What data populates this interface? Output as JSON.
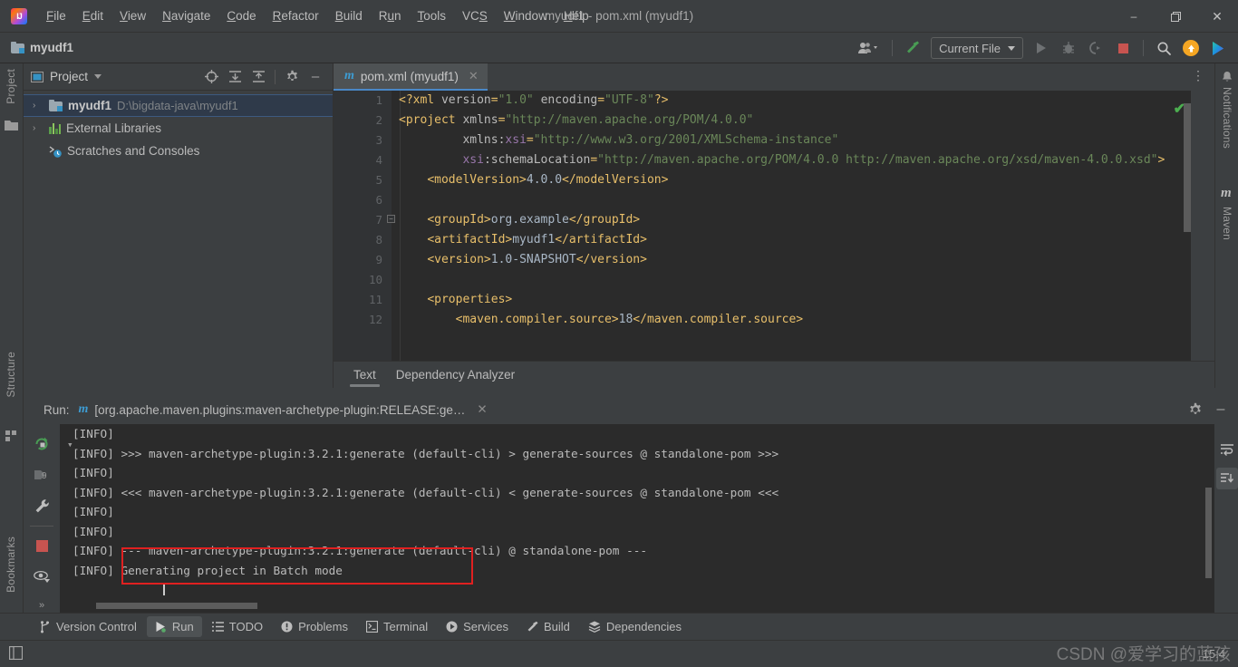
{
  "window": {
    "title": "myudf1 - pom.xml (myudf1)",
    "minimize": "─",
    "maximize": "❐",
    "close": "✕",
    "logo_text": "IJ"
  },
  "menu": {
    "items": [
      "File",
      "Edit",
      "View",
      "Navigate",
      "Code",
      "Refactor",
      "Build",
      "Run",
      "Tools",
      "VCS",
      "Window",
      "Help"
    ]
  },
  "navbar": {
    "project_name": "myudf1",
    "run_config": "Current File",
    "icons": {
      "account": "account-icon",
      "build": "hammer-icon",
      "run": "run-icon",
      "debug": "debug-icon",
      "coverage": "run-coverage-icon",
      "stop": "stop-icon",
      "search": "search-icon",
      "update": "update-icon",
      "ide_feature": "ide-feature-icon"
    }
  },
  "left_strip": {
    "project_label": "Project",
    "structure_label": "Structure",
    "bookmarks_label": "Bookmarks"
  },
  "right_strip": {
    "notifications_label": "Notifications",
    "maven_label": "Maven",
    "maven_glyph": "m"
  },
  "project_panel": {
    "title": "Project",
    "tree": [
      {
        "name": "myudf1",
        "detail": "D:\\bigdata-java\\myudf1",
        "arrow": "›",
        "selected": true,
        "icon": "module-folder-icon"
      },
      {
        "name": "External Libraries",
        "detail": "",
        "arrow": "›",
        "selected": false,
        "icon": "libraries-icon"
      },
      {
        "name": "Scratches and Consoles",
        "detail": "",
        "arrow": "",
        "selected": false,
        "icon": "scratches-icon"
      }
    ]
  },
  "editor": {
    "tab": {
      "label": "pom.xml (myudf1)",
      "icon_glyph": "m",
      "close": "✕"
    },
    "overflow": "⋮",
    "inspection_ok": "✔",
    "lines": [
      {
        "n": 1,
        "fold": "",
        "tokens": [
          {
            "t": "pi",
            "v": "<?xml "
          },
          {
            "t": "attr",
            "v": "version"
          },
          {
            "t": "pi",
            "v": "="
          },
          {
            "t": "str",
            "v": "\"1.0\""
          },
          {
            "t": "pi",
            "v": " "
          },
          {
            "t": "attr",
            "v": "encoding"
          },
          {
            "t": "pi",
            "v": "="
          },
          {
            "t": "str",
            "v": "\"UTF-8\""
          },
          {
            "t": "pi",
            "v": "?>"
          }
        ]
      },
      {
        "n": 2,
        "fold": "minus",
        "tokens": [
          {
            "t": "tag",
            "v": "<project "
          },
          {
            "t": "attr",
            "v": "xmlns"
          },
          {
            "t": "tag",
            "v": "="
          },
          {
            "t": "str",
            "v": "\"http://maven.apache.org/POM/4.0.0\""
          }
        ]
      },
      {
        "n": 3,
        "fold": "",
        "tokens": [
          {
            "t": "plain",
            "v": "         "
          },
          {
            "t": "attr",
            "v": "xmlns:"
          },
          {
            "t": "ns",
            "v": "xsi"
          },
          {
            "t": "tag",
            "v": "="
          },
          {
            "t": "str",
            "v": "\"http://www.w3.org/2001/XMLSchema-instance\""
          }
        ]
      },
      {
        "n": 4,
        "fold": "",
        "tokens": [
          {
            "t": "plain",
            "v": "         "
          },
          {
            "t": "ns",
            "v": "xsi"
          },
          {
            "t": "attr",
            "v": ":schemaLocation"
          },
          {
            "t": "tag",
            "v": "="
          },
          {
            "t": "str",
            "v": "\"http://maven.apache.org/POM/4.0.0 http://maven.apache.org/xsd/maven-4.0.0.xsd\""
          },
          {
            "t": "tag",
            "v": ">"
          }
        ]
      },
      {
        "n": 5,
        "fold": "",
        "tokens": [
          {
            "t": "plain",
            "v": "    "
          },
          {
            "t": "tag",
            "v": "<modelVersion>"
          },
          {
            "t": "txt",
            "v": "4.0.0"
          },
          {
            "t": "tag",
            "v": "</modelVersion>"
          }
        ]
      },
      {
        "n": 6,
        "fold": "",
        "tokens": []
      },
      {
        "n": 7,
        "fold": "",
        "tokens": [
          {
            "t": "plain",
            "v": "    "
          },
          {
            "t": "tag",
            "v": "<groupId>"
          },
          {
            "t": "txt",
            "v": "org.example"
          },
          {
            "t": "tag",
            "v": "</groupId>"
          }
        ]
      },
      {
        "n": 8,
        "fold": "",
        "tokens": [
          {
            "t": "plain",
            "v": "    "
          },
          {
            "t": "tag",
            "v": "<artifactId>"
          },
          {
            "t": "txt",
            "v": "myudf1"
          },
          {
            "t": "tag",
            "v": "</artifactId>"
          }
        ]
      },
      {
        "n": 9,
        "fold": "",
        "tokens": [
          {
            "t": "plain",
            "v": "    "
          },
          {
            "t": "tag",
            "v": "<version>"
          },
          {
            "t": "txt",
            "v": "1.0-SNAPSHOT"
          },
          {
            "t": "tag",
            "v": "</version>"
          }
        ]
      },
      {
        "n": 10,
        "fold": "",
        "tokens": []
      },
      {
        "n": 11,
        "fold": "minus",
        "tokens": [
          {
            "t": "plain",
            "v": "    "
          },
          {
            "t": "tag",
            "v": "<properties>"
          }
        ]
      },
      {
        "n": 12,
        "fold": "",
        "tokens": [
          {
            "t": "plain",
            "v": "        "
          },
          {
            "t": "tag",
            "v": "<maven.compiler.source>"
          },
          {
            "t": "txt",
            "v": "18"
          },
          {
            "t": "tag",
            "v": "</maven.compiler.source>"
          }
        ]
      }
    ],
    "subtabs": [
      {
        "label": "Text",
        "active": true
      },
      {
        "label": "Dependency Analyzer",
        "active": false
      }
    ]
  },
  "run_panel": {
    "label": "Run:",
    "config_name": "[org.apache.maven.plugins:maven-archetype-plugin:RELEASE:ge…",
    "config_icon_glyph": "m",
    "close": "✕",
    "settings_icon": "gear-icon",
    "minimize_icon": "minimize-icon",
    "side_icons": [
      "rerun-icon",
      "rerun-failed-icon",
      "settings-wrench-icon",
      "stop-icon",
      "eye-filter-icon",
      "expand-more-icon"
    ],
    "right_icons": [
      "soft-wrap-icon",
      "scroll-to-end-icon"
    ],
    "console_lines": [
      "[INFO]",
      "[INFO] >>> maven-archetype-plugin:3.2.1:generate (default-cli) > generate-sources @ standalone-pom >>>",
      "[INFO]",
      "[INFO] <<< maven-archetype-plugin:3.2.1:generate (default-cli) < generate-sources @ standalone-pom <<<",
      "[INFO]",
      "[INFO]",
      "[INFO] --- maven-archetype-plugin:3.2.1:generate (default-cli) @ standalone-pom ---",
      "[INFO] Generating project in Batch mode"
    ],
    "highlight_color": "#e02020"
  },
  "bottom_bar": {
    "items": [
      {
        "label": "Version Control",
        "icon": "branch-icon",
        "active": false
      },
      {
        "label": "Run",
        "icon": "run-icon",
        "active": true
      },
      {
        "label": "TODO",
        "icon": "todo-list-icon",
        "active": false
      },
      {
        "label": "Problems",
        "icon": "problems-icon",
        "active": false
      },
      {
        "label": "Terminal",
        "icon": "terminal-icon",
        "active": false
      },
      {
        "label": "Services",
        "icon": "services-icon",
        "active": false
      },
      {
        "label": "Build",
        "icon": "build-hammer-icon",
        "active": false
      },
      {
        "label": "Dependencies",
        "icon": "dependencies-icon",
        "active": false
      }
    ]
  },
  "status_bar": {
    "left_icon": "layout-icon",
    "caret_position": "15:4",
    "watermark": "CSDN @爱学习的蓝孩"
  }
}
